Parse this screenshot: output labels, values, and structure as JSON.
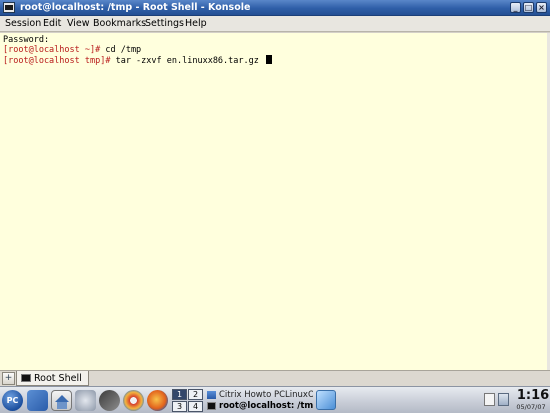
{
  "window": {
    "title": "root@localhost: /tmp - Root Shell - Konsole",
    "buttons": {
      "minimize": "_",
      "maximize": "□",
      "close": "×"
    }
  },
  "menu": [
    "Session",
    "Edit",
    "View",
    "Bookmarks",
    "Settings",
    "Help"
  ],
  "terminal": {
    "lines": [
      {
        "prompt": "",
        "command": "Password:"
      },
      {
        "prompt": "[root@localhost ~]#",
        "command": " cd /tmp"
      },
      {
        "prompt": "[root@localhost tmp]#",
        "command": " tar -zxvf en.linuxx86.tar.gz"
      }
    ],
    "colors": {
      "background": "#ffffdd",
      "prompt": "#b81b1b",
      "text": "#000000"
    }
  },
  "tabs": {
    "new_tab_icon": "new-session-icon",
    "active_tab": "Root Shell"
  },
  "taskbar": {
    "start_label": "PC",
    "pager": [
      "1",
      "2",
      "3",
      "4"
    ],
    "tasks": [
      {
        "label": "Citrix Howto PCLinuxOS",
        "icon": "konqueror-icon"
      },
      {
        "label": "root@localhost: /tmp",
        "icon": "konsole-icon"
      }
    ],
    "clock": {
      "time": "1:16",
      "date": "05/07/07"
    }
  }
}
